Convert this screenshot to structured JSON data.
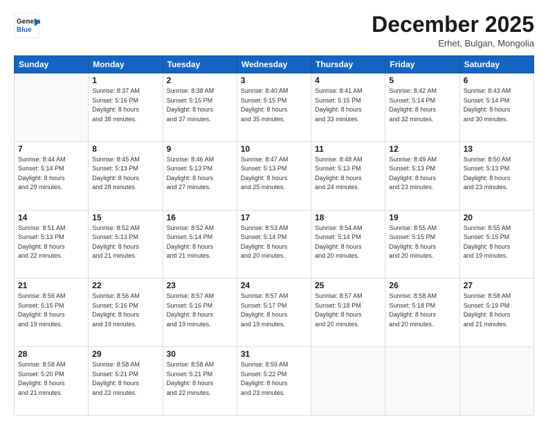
{
  "header": {
    "logo_general": "General",
    "logo_blue": "Blue",
    "month_title": "December 2025",
    "location": "Erhet, Bulgan, Mongolia"
  },
  "days_of_week": [
    "Sunday",
    "Monday",
    "Tuesday",
    "Wednesday",
    "Thursday",
    "Friday",
    "Saturday"
  ],
  "weeks": [
    [
      {
        "day": "",
        "info": ""
      },
      {
        "day": "1",
        "info": "Sunrise: 8:37 AM\nSunset: 5:16 PM\nDaylight: 8 hours\nand 38 minutes."
      },
      {
        "day": "2",
        "info": "Sunrise: 8:38 AM\nSunset: 5:15 PM\nDaylight: 8 hours\nand 37 minutes."
      },
      {
        "day": "3",
        "info": "Sunrise: 8:40 AM\nSunset: 5:15 PM\nDaylight: 8 hours\nand 35 minutes."
      },
      {
        "day": "4",
        "info": "Sunrise: 8:41 AM\nSunset: 5:15 PM\nDaylight: 8 hours\nand 33 minutes."
      },
      {
        "day": "5",
        "info": "Sunrise: 8:42 AM\nSunset: 5:14 PM\nDaylight: 8 hours\nand 32 minutes."
      },
      {
        "day": "6",
        "info": "Sunrise: 8:43 AM\nSunset: 5:14 PM\nDaylight: 8 hours\nand 30 minutes."
      }
    ],
    [
      {
        "day": "7",
        "info": "Sunrise: 8:44 AM\nSunset: 5:14 PM\nDaylight: 8 hours\nand 29 minutes."
      },
      {
        "day": "8",
        "info": "Sunrise: 8:45 AM\nSunset: 5:13 PM\nDaylight: 8 hours\nand 28 minutes."
      },
      {
        "day": "9",
        "info": "Sunrise: 8:46 AM\nSunset: 5:13 PM\nDaylight: 8 hours\nand 27 minutes."
      },
      {
        "day": "10",
        "info": "Sunrise: 8:47 AM\nSunset: 5:13 PM\nDaylight: 8 hours\nand 25 minutes."
      },
      {
        "day": "11",
        "info": "Sunrise: 8:48 AM\nSunset: 5:13 PM\nDaylight: 8 hours\nand 24 minutes."
      },
      {
        "day": "12",
        "info": "Sunrise: 8:49 AM\nSunset: 5:13 PM\nDaylight: 8 hours\nand 23 minutes."
      },
      {
        "day": "13",
        "info": "Sunrise: 8:50 AM\nSunset: 5:13 PM\nDaylight: 8 hours\nand 23 minutes."
      }
    ],
    [
      {
        "day": "14",
        "info": "Sunrise: 8:51 AM\nSunset: 5:13 PM\nDaylight: 8 hours\nand 22 minutes."
      },
      {
        "day": "15",
        "info": "Sunrise: 8:52 AM\nSunset: 5:13 PM\nDaylight: 8 hours\nand 21 minutes."
      },
      {
        "day": "16",
        "info": "Sunrise: 8:52 AM\nSunset: 5:14 PM\nDaylight: 8 hours\nand 21 minutes."
      },
      {
        "day": "17",
        "info": "Sunrise: 8:53 AM\nSunset: 5:14 PM\nDaylight: 8 hours\nand 20 minutes."
      },
      {
        "day": "18",
        "info": "Sunrise: 8:54 AM\nSunset: 5:14 PM\nDaylight: 8 hours\nand 20 minutes."
      },
      {
        "day": "19",
        "info": "Sunrise: 8:55 AM\nSunset: 5:15 PM\nDaylight: 8 hours\nand 20 minutes."
      },
      {
        "day": "20",
        "info": "Sunrise: 8:55 AM\nSunset: 5:15 PM\nDaylight: 8 hours\nand 19 minutes."
      }
    ],
    [
      {
        "day": "21",
        "info": "Sunrise: 8:56 AM\nSunset: 5:15 PM\nDaylight: 8 hours\nand 19 minutes."
      },
      {
        "day": "22",
        "info": "Sunrise: 8:56 AM\nSunset: 5:16 PM\nDaylight: 8 hours\nand 19 minutes."
      },
      {
        "day": "23",
        "info": "Sunrise: 8:57 AM\nSunset: 5:16 PM\nDaylight: 8 hours\nand 19 minutes."
      },
      {
        "day": "24",
        "info": "Sunrise: 8:57 AM\nSunset: 5:17 PM\nDaylight: 8 hours\nand 19 minutes."
      },
      {
        "day": "25",
        "info": "Sunrise: 8:57 AM\nSunset: 5:18 PM\nDaylight: 8 hours\nand 20 minutes."
      },
      {
        "day": "26",
        "info": "Sunrise: 8:58 AM\nSunset: 5:18 PM\nDaylight: 8 hours\nand 20 minutes."
      },
      {
        "day": "27",
        "info": "Sunrise: 8:58 AM\nSunset: 5:19 PM\nDaylight: 8 hours\nand 21 minutes."
      }
    ],
    [
      {
        "day": "28",
        "info": "Sunrise: 8:58 AM\nSunset: 5:20 PM\nDaylight: 8 hours\nand 21 minutes."
      },
      {
        "day": "29",
        "info": "Sunrise: 8:58 AM\nSunset: 5:21 PM\nDaylight: 8 hours\nand 22 minutes."
      },
      {
        "day": "30",
        "info": "Sunrise: 8:58 AM\nSunset: 5:21 PM\nDaylight: 8 hours\nand 22 minutes."
      },
      {
        "day": "31",
        "info": "Sunrise: 8:59 AM\nSunset: 5:22 PM\nDaylight: 8 hours\nand 23 minutes."
      },
      {
        "day": "",
        "info": ""
      },
      {
        "day": "",
        "info": ""
      },
      {
        "day": "",
        "info": ""
      }
    ]
  ]
}
